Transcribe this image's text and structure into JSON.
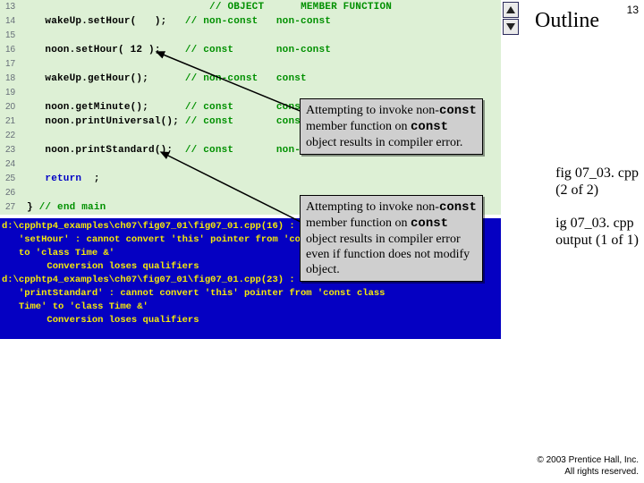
{
  "page_number": "13",
  "outline_title": "Outline",
  "code": {
    "lines": [
      {
        "n": "13",
        "fragments": [
          {
            "t": "                              "
          },
          {
            "t": "// OBJECT      MEMBER FUNCTION",
            "cls": "com"
          }
        ]
      },
      {
        "n": "14",
        "fragments": [
          {
            "t": "   wakeUp.setHour(   );   "
          },
          {
            "t": "// non-const   non-const",
            "cls": "com"
          }
        ]
      },
      {
        "n": "15",
        "fragments": []
      },
      {
        "n": "16",
        "fragments": [
          {
            "t": "   noon.setHour( 12 );    "
          },
          {
            "t": "// const       non-const",
            "cls": "com"
          }
        ]
      },
      {
        "n": "17",
        "fragments": []
      },
      {
        "n": "18",
        "fragments": [
          {
            "t": "   wakeUp.getHour();      "
          },
          {
            "t": "// non-const   const",
            "cls": "com"
          }
        ]
      },
      {
        "n": "19",
        "fragments": []
      },
      {
        "n": "20",
        "fragments": [
          {
            "t": "   noon.getMinute();      "
          },
          {
            "t": "// const       const",
            "cls": "com"
          }
        ]
      },
      {
        "n": "21",
        "fragments": [
          {
            "t": "   noon.printUniversal(); "
          },
          {
            "t": "// const       const",
            "cls": "com"
          }
        ]
      },
      {
        "n": "22",
        "fragments": []
      },
      {
        "n": "23",
        "fragments": [
          {
            "t": "   noon.printStandard();  "
          },
          {
            "t": "// const       non-const",
            "cls": "com"
          }
        ]
      },
      {
        "n": "24",
        "fragments": []
      },
      {
        "n": "25",
        "fragments": [
          {
            "t": "   "
          },
          {
            "t": "return",
            "cls": "kw"
          },
          {
            "t": "  ;"
          }
        ]
      },
      {
        "n": "26",
        "fragments": []
      },
      {
        "n": "27",
        "fragments": [
          {
            "t": "} "
          },
          {
            "t": "// end main",
            "cls": "com"
          }
        ]
      }
    ]
  },
  "console_text": "d:\\cpphtp4_examples\\ch07\\fig07_01\\fig07_01.cpp(16) : error C2662:\n   'setHour' : cannot convert 'this' pointer from 'const class Time'\n   to 'class Time &'\n        Conversion loses qualifiers\nd:\\cpphtp4_examples\\ch07\\fig07_01\\fig07_01.cpp(23) : error C2662:\n   'printStandard' : cannot convert 'this' pointer from 'const class\n   Time' to 'class Time &'\n        Conversion loses qualifiers",
  "callout1": [
    "Attempting to invoke non-",
    "const",
    " member function on ",
    "const",
    " object results in compiler error."
  ],
  "callout2": [
    "Attempting to invoke non-",
    "const",
    " member function on ",
    "const",
    " object results in compiler error even if function does not modify object."
  ],
  "figref1": {
    "a": "fig 07_03. cpp",
    "b": "(2 of 2)"
  },
  "figref2": {
    "a": "ig 07_03. cpp",
    "b": "output (1 of 1)"
  },
  "footer": {
    "a": "© 2003 Prentice Hall, Inc.",
    "b": "All rights reserved."
  }
}
